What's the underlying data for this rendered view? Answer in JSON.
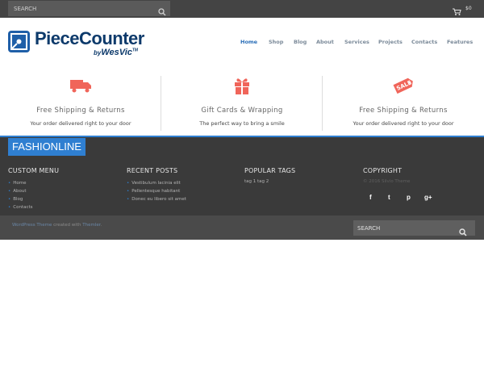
{
  "topbar": {
    "search_placeholder": "SEARCH",
    "cart_amount": "$0"
  },
  "logo": {
    "text": "PieceCounter",
    "sub_prefix": "by",
    "sub_brand": "WesVic",
    "sub_tm": "TM"
  },
  "nav": [
    {
      "label": "Home"
    },
    {
      "label": "Shop"
    },
    {
      "label": "Blog"
    },
    {
      "label": "About"
    },
    {
      "label": "Services"
    },
    {
      "label": "Projects"
    },
    {
      "label": "Contacts"
    },
    {
      "label": "Features"
    }
  ],
  "features": [
    {
      "icon": "truck-icon",
      "title": "Free Shipping & Returns",
      "subtitle": "Your order delivered right to your door"
    },
    {
      "icon": "gift-icon",
      "title": "Gift Cards & Wrapping",
      "subtitle": "The perfect way to bring a smile"
    },
    {
      "icon": "sale-tag-icon",
      "title": "Free Shipping & Returns",
      "subtitle": "Your order delivered right to your door",
      "tag_text": "SALE"
    }
  ],
  "footer": {
    "brand": "FASHIONLINE",
    "custom_menu": {
      "title": "CUSTOM MENU",
      "items": [
        "Home",
        "About",
        "Blog",
        "Contacts"
      ]
    },
    "recent_posts": {
      "title": "RECENT POSTS",
      "items": [
        "Vestibulum lacinia elit",
        "Pellentesque habitant",
        "Donec eu libero sit amet"
      ]
    },
    "popular_tags": {
      "title": "POPULAR TAGS",
      "tags": "tag 1  tag 2"
    },
    "copyright": {
      "title": "COPYRIGHT",
      "text": "© 2016 Silvio Theme"
    },
    "social": [
      {
        "icon": "facebook-icon",
        "glyph": "f"
      },
      {
        "icon": "tumblr-icon",
        "glyph": "t"
      },
      {
        "icon": "pinterest-icon",
        "glyph": "p"
      },
      {
        "icon": "google-plus-icon",
        "glyph": "g+"
      }
    ]
  },
  "bottombar": {
    "credit_link1": "WordPress Theme",
    "credit_mid": " created with ",
    "credit_link2": "Themler",
    "credit_end": ".",
    "search_placeholder": "SEARCH"
  },
  "colors": {
    "accent": "#2f7fd1",
    "topbar": "#444444",
    "footer": "#3a3a3a",
    "feature_icon": "#f0655a"
  }
}
